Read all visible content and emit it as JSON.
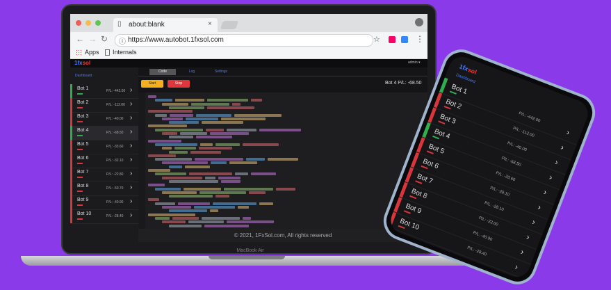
{
  "browser": {
    "tab_title": "about:blank",
    "tab_close": "×",
    "url": "https://www.autobot.1fxsol.com",
    "bookmarks": {
      "apps": "Apps",
      "internals": "Internals"
    }
  },
  "app": {
    "logo_main": "1fx",
    "logo_accent": "sol",
    "user_menu": "admin ▾",
    "sidebar_header": "Dashboard",
    "tabs": [
      "Code",
      "Log",
      "Settings"
    ],
    "start_button": "Start",
    "stop_button": "Stop",
    "selected_pl": "Bot 4 P/L: -68.50",
    "bots": [
      {
        "name": "Bot 1",
        "pl": "P/L: -442.00"
      },
      {
        "name": "Bot 2",
        "pl": "P/L: -112.00"
      },
      {
        "name": "Bot 3",
        "pl": "P/L: -40.00"
      },
      {
        "name": "Bot 4",
        "pl": "P/L: -68.50"
      },
      {
        "name": "Bot 5",
        "pl": "P/L: -33.60"
      },
      {
        "name": "Bot 6",
        "pl": "P/L: -32.10"
      },
      {
        "name": "Bot 7",
        "pl": "P/L: -22.80"
      },
      {
        "name": "Bot 8",
        "pl": "P/L: -50.70"
      },
      {
        "name": "Bot 9",
        "pl": "P/L: -40.90"
      },
      {
        "name": "Bot 10",
        "pl": "P/L: -28.40"
      }
    ],
    "footer": "© 2021, 1FxSol.com, All rights reserved"
  },
  "laptop_brand": "MacBook Air",
  "phone": {
    "header": "Dashboard",
    "bots": [
      {
        "name": "Bot 1",
        "pl": "P/L: -442.00"
      },
      {
        "name": "Bot 2",
        "pl": "P/L: -112.00"
      },
      {
        "name": "Bot 3",
        "pl": "P/L: -40.00"
      },
      {
        "name": "Bot 4",
        "pl": "P/L: -68.50"
      },
      {
        "name": "Bot 5",
        "pl": "P/L: -33.60"
      },
      {
        "name": "Bot 6",
        "pl": "P/L: -28.10"
      },
      {
        "name": "Bot 7",
        "pl": "P/L: -28.10"
      },
      {
        "name": "Bot 8",
        "pl": "P/L: -22.00"
      },
      {
        "name": "Bot 9",
        "pl": "P/L: -40.90"
      },
      {
        "name": "Bot 10",
        "pl": "P/L: -28.40"
      }
    ]
  },
  "colors": {
    "background": "#8a3ae8",
    "profit_green": "#2fae4e",
    "loss_red": "#d8363c",
    "accent_blue": "#4a7bff",
    "start_yellow": "#f2b01e",
    "stop_red": "#e0363c"
  },
  "bot_state_colors": [
    "green",
    "red",
    "red",
    "green",
    "red",
    "red",
    "red",
    "red",
    "red",
    "red"
  ],
  "phone_state_colors": [
    "green",
    "red",
    "red",
    "green",
    "red",
    "red",
    "red",
    "red",
    "red",
    "red"
  ],
  "icons": {
    "traffic_lights": [
      "close-dot",
      "minimize-dot",
      "maximize-dot"
    ],
    "nav": [
      "back-arrow-icon",
      "forward-arrow-icon",
      "reload-icon"
    ]
  }
}
